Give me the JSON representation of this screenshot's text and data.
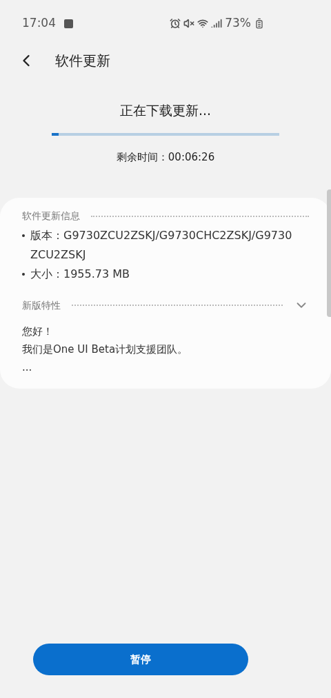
{
  "status_bar": {
    "time": "17:04",
    "battery": "73%"
  },
  "header": {
    "title": "软件更新"
  },
  "download": {
    "status": "正在下载更新...",
    "level": 0.03,
    "remaining": "剩余时间：00:06:26"
  },
  "info": {
    "heading": "软件更新信息",
    "items": [
      "版本：G9730ZCU2ZSKJ/G9730CHC2ZSKJ/G9730ZCU2ZSKJ",
      "大小：1955.73 MB"
    ]
  },
  "features": {
    "heading": "新版特性",
    "expanded": false,
    "lines": [
      "您好！",
      "我们是One UI Beta计划支援团队。",
      "..."
    ]
  },
  "button": {
    "label": "暂停"
  }
}
